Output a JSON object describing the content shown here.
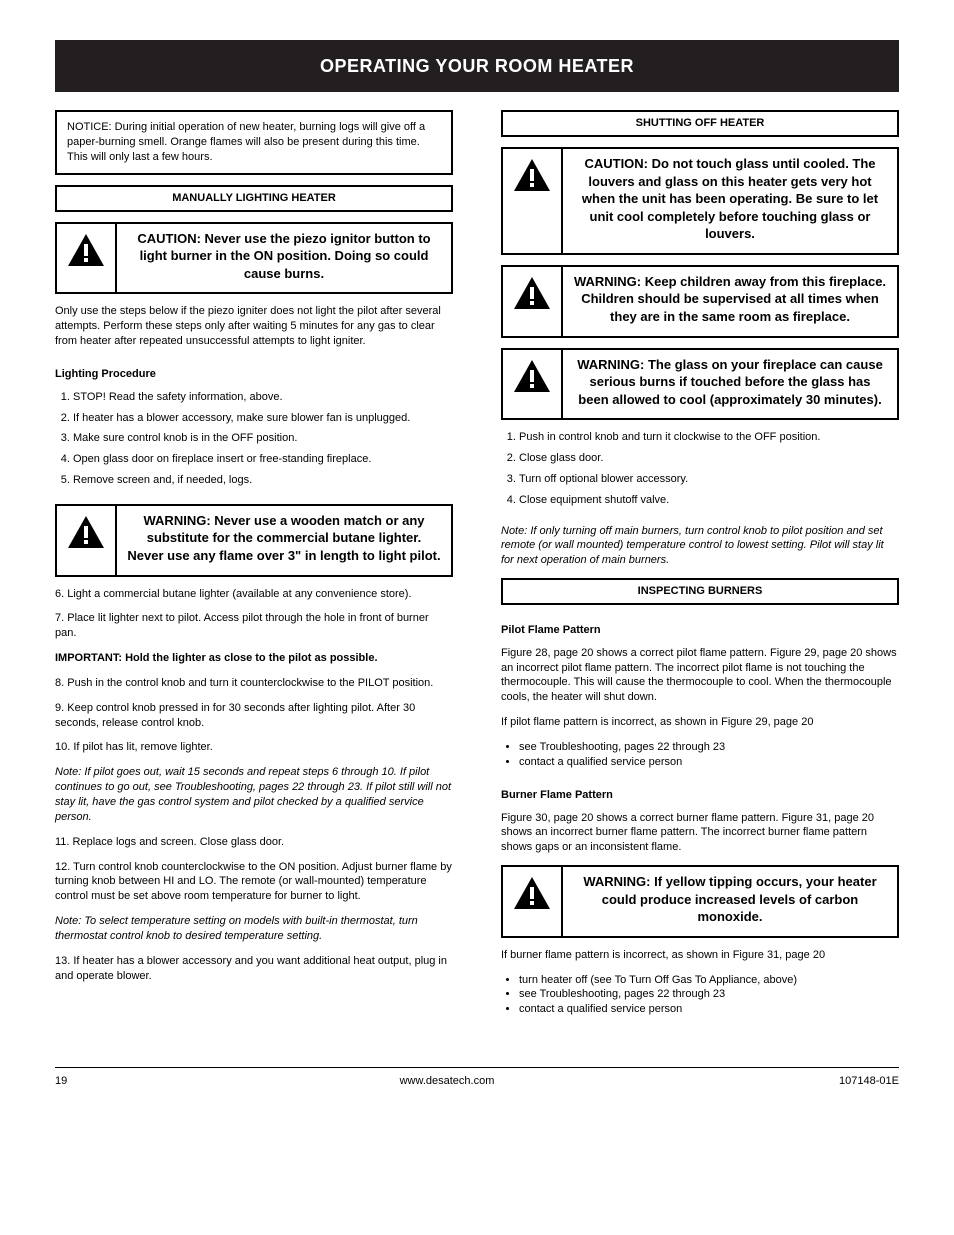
{
  "banner": "OPERATING YOUR ROOM HEATER",
  "left": {
    "notice": "NOTICE: During initial operation of new heater, burning logs will give off a paper-burning smell. Orange flames will also be present during this time. This will only last a few hours.",
    "sectionTitle": "MANUALLY LIGHTING HEATER",
    "manualCaution": {
      "head": "CAUTION:",
      "body": "Never use the piezo ignitor button to light burner in the ON position. Doing so could cause burns."
    },
    "afterCaution1": "Only use the steps below if the piezo igniter does not light the pilot after several attempts. Perform these steps only after waiting 5 minutes for any gas to clear from heater after repeated unsuccessful attempts to light igniter.",
    "procTitle": "Lighting Procedure",
    "steps1": [
      "STOP! Read the safety information, above.",
      "If heater has a blower accessory, make sure blower fan is unplugged.",
      "Make sure control knob is in the OFF position.",
      "Open glass door on fireplace insert or free-standing fireplace.",
      "Remove screen and, if needed, logs."
    ],
    "woodWarn": {
      "head": "WARNING:",
      "body": "Never use a wooden match or any substitute for the commercial butane lighter. Never use any flame over 3\" in length to light pilot."
    },
    "steps2": [
      {
        "n": "6.",
        "t": "Light a commercial butane lighter (available at any convenience store)."
      },
      {
        "n": "7.",
        "t": "Place lit lighter next to pilot. Access pilot through the hole in front of burner pan."
      }
    ],
    "important": "IMPORTANT: Hold the lighter as close to the pilot as possible.",
    "steps3": [
      {
        "n": "8.",
        "t": "Push in the control knob and turn it counterclockwise to the PILOT position."
      },
      {
        "n": "9.",
        "t": "Keep control knob pressed in for 30 seconds after lighting pilot. After 30 seconds, release control knob."
      },
      {
        "n": "10.",
        "t": "If pilot has lit, remove lighter."
      }
    ],
    "note1": "Note: If pilot goes out, wait 15 seconds and repeat steps 6 through 10. If pilot continues to go out, see Troubleshooting, pages 22 through 23. If pilot still will not stay lit, have the gas control system and pilot checked by a qualified service person.",
    "steps4": [
      {
        "n": "11.",
        "t": "Replace logs and screen. Close glass door."
      },
      {
        "n": "12.",
        "t": "Turn control knob counterclockwise to the ON position. Adjust burner flame by turning knob between HI and LO. The remote (or wall-mounted) temperature control must be set above room temperature for burner to light."
      }
    ],
    "note2": "Note: To select temperature setting on models with built-in thermostat, turn thermostat control knob to desired temperature setting.",
    "steps5": [
      {
        "n": "13.",
        "t": "If heater has a blower accessory and you want additional heat output, plug in and operate blower."
      }
    ]
  },
  "right": {
    "shutTitle": "SHUTTING OFF HEATER",
    "shutCaution": {
      "head": "CAUTION:",
      "body": "Do not touch glass until cooled. The louvers and glass on this heater gets very hot when the unit has been operating. Be sure to let unit cool completely before touching glass or louvers."
    },
    "childWarn": {
      "head": "WARNING:",
      "body": "Keep children away from this fireplace. Children should be supervised at all times when they are in the same room as fireplace."
    },
    "glassWarn": {
      "head": "WARNING:",
      "body": "The glass on your fireplace can cause serious burns if touched before the glass has been allowed to cool (approximately 30 minutes)."
    },
    "shutSteps": [
      "Push in control knob and turn it clockwise to the OFF position.",
      "Close glass door.",
      "Turn off optional blower accessory.",
      "Close equipment shutoff valve."
    ],
    "noteShut": "Note: If only turning off main burners, turn control knob to pilot position and set remote (or wall mounted) temperature control to lowest setting. Pilot will stay lit for next operation of main burners.",
    "inspectTitle": "INSPECTING BURNERS",
    "pilotTitle": "Pilot Flame Pattern",
    "pilotPara1": "Figure 28, page 20 shows a correct pilot flame pattern. Figure 29, page 20 shows an incorrect pilot flame pattern. The incorrect pilot flame is not touching the thermocouple. This will cause the thermocouple to cool. When the thermocouple cools, the heater will shut down.",
    "pilotPara2": "If pilot flame pattern is incorrect, as shown in Figure 29, page 20",
    "pilotBullets": [
      "see Troubleshooting, pages 22 through 23",
      "contact a qualified service person"
    ],
    "burnerTitle": "Burner Flame Pattern",
    "burnerPara": "Figure 30, page 20 shows a correct burner flame pattern. Figure 31, page 20 shows an incorrect burner flame pattern. The incorrect burner flame pattern shows gaps or an inconsistent flame.",
    "burnerWarn": {
      "head": "WARNING:",
      "body": "If yellow tipping occurs, your heater could produce increased levels of carbon monoxide."
    },
    "burnerPara2": "If burner flame pattern is incorrect, as shown in Figure 31, page 20",
    "burnerBullets": [
      "turn heater off (see To Turn Off Gas To Appliance, above)",
      "see Troubleshooting, pages 22 through 23",
      "contact a qualified service person"
    ]
  },
  "footer": {
    "page": "19",
    "center": "www.desatech.com",
    "right": "107148-01E"
  }
}
